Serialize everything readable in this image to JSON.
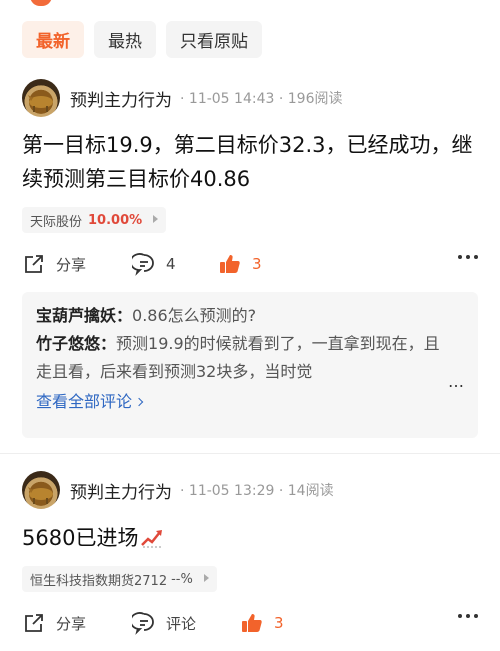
{
  "colors": {
    "accent": "#f2632b",
    "link": "#2e67c2",
    "up": "#e0493a"
  },
  "tabs": [
    {
      "label": "最新",
      "active": true
    },
    {
      "label": "最热",
      "active": false
    },
    {
      "label": "只看原贴",
      "active": false
    }
  ],
  "posts": [
    {
      "author": "预判主力行为",
      "time": "11-05 14:43",
      "reads": "196阅读",
      "content": "第一目标19.9，第二目标价32.3，已经成功，继续预测第三目标价40.86",
      "stock": {
        "name": "天际股份",
        "pct": "10.00%"
      },
      "actions": {
        "share": "分享",
        "comment": "4",
        "like": "3"
      },
      "comments": [
        {
          "name": "宝葫芦擒妖：",
          "text": "0.86怎么预测的?"
        },
        {
          "name": "竹子悠悠：",
          "text": "预测19.9的时候就看到了，一直拿到现在，且走且看，后来看到预测32块多，当时觉"
        }
      ],
      "view_all": "查看全部评论"
    },
    {
      "author": "预判主力行为",
      "time": "11-05 13:29",
      "reads": "14阅读",
      "content": "5680已进场",
      "stock": {
        "name": "恒生科技指数期货2712",
        "pct": "--%"
      },
      "actions": {
        "share": "分享",
        "comment": "评论",
        "like": "3"
      }
    }
  ]
}
